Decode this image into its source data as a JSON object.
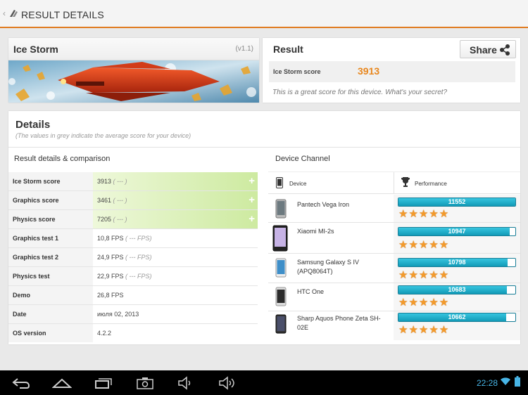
{
  "header": {
    "title": "RESULT DETAILS"
  },
  "ice_storm": {
    "title": "Ice Storm",
    "version": "(v1.1)"
  },
  "result": {
    "title": "Result",
    "share_label": "Share",
    "score_label": "Ice Storm score",
    "score_value": "3913",
    "message": "This is a great score for this device. What's your secret?"
  },
  "details": {
    "title": "Details",
    "subtitle": "(The values in grey indicate the average score for your device)",
    "comparison_title": "Result details & comparison",
    "rows": [
      {
        "label": "Ice Storm score",
        "value": "3913",
        "avg": "( --- )"
      },
      {
        "label": "Graphics score",
        "value": "3461",
        "avg": "( --- )"
      },
      {
        "label": "Physics score",
        "value": "7205",
        "avg": "( --- )"
      },
      {
        "label": "Graphics test 1",
        "value": "10,8 FPS",
        "avg": "( --- FPS)"
      },
      {
        "label": "Graphics test 2",
        "value": "24,9 FPS",
        "avg": "( --- FPS)"
      },
      {
        "label": "Physics test",
        "value": "22,9 FPS",
        "avg": "( --- FPS)"
      },
      {
        "label": "Demo",
        "value": "26,8 FPS",
        "avg": ""
      },
      {
        "label": "Date",
        "value": "июля 02, 2013",
        "avg": ""
      },
      {
        "label": "OS version",
        "value": "4.2.2",
        "avg": ""
      }
    ]
  },
  "device_channel": {
    "title": "Device Channel",
    "col_device": "Device",
    "col_performance": "Performance",
    "devices": [
      {
        "name": "Pantech Vega Iron",
        "score": "11552",
        "fill": 1.0
      },
      {
        "name": "Xiaomi MI-2s",
        "score": "10947",
        "fill": 0.95
      },
      {
        "name": "Samsung Galaxy S IV (APQ8064T)",
        "score": "10798",
        "fill": 0.935
      },
      {
        "name": "HTC One",
        "score": "10683",
        "fill": 0.925
      },
      {
        "name": "Sharp Aquos Phone Zeta SH-02E",
        "score": "10662",
        "fill": 0.923
      }
    ],
    "stars": "★★★★★"
  },
  "status_bar": {
    "time": "22:28"
  },
  "colors": {
    "accent": "#e07a1f",
    "score": "#e8861c",
    "bar": "#1ea9c6",
    "highlight": "#cdeaa0"
  }
}
